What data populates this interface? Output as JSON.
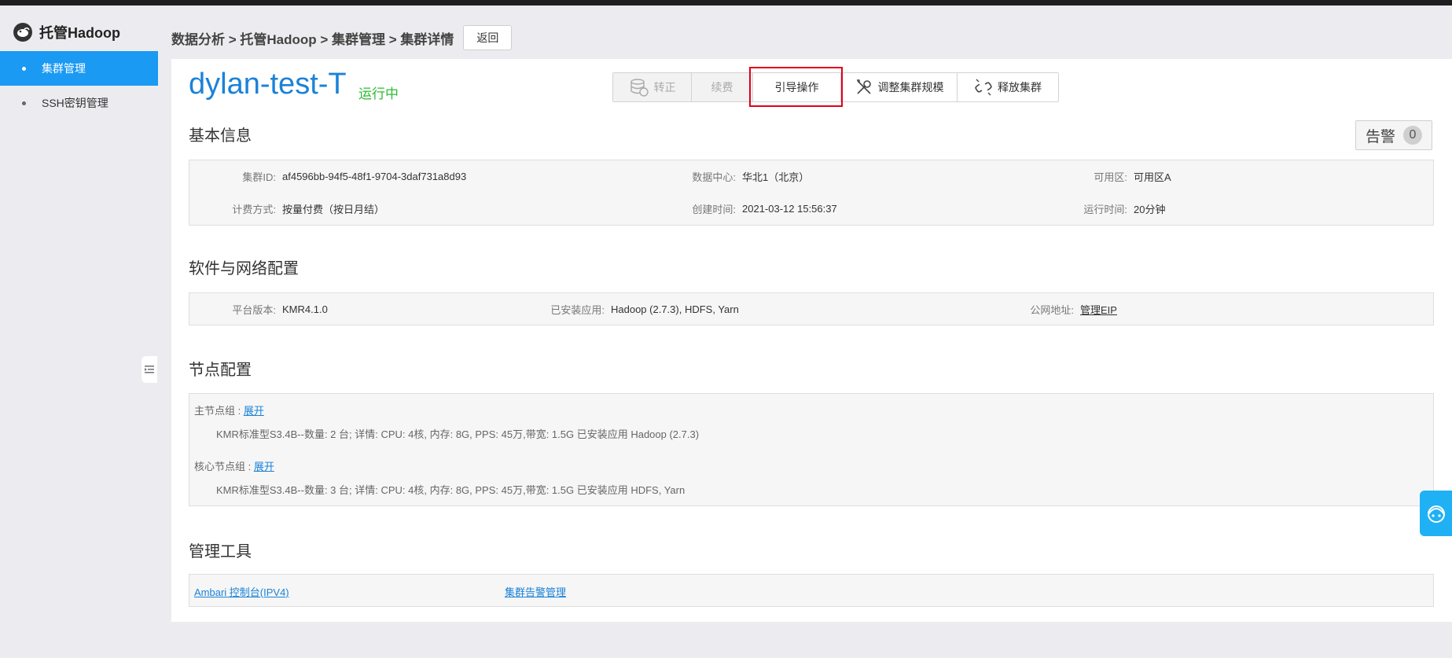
{
  "app": {
    "title": "托管Hadoop"
  },
  "sidebar": {
    "items": [
      {
        "label": "集群管理",
        "active": true
      },
      {
        "label": "SSH密钥管理",
        "active": false
      }
    ]
  },
  "header": {
    "breadcrumb": "数据分析 > 托管Hadoop > 集群管理 > 集群详情",
    "back_label": "返回"
  },
  "cluster": {
    "name": "dylan-test-T",
    "status": "运行中",
    "status_color": "#2ebb35"
  },
  "actions": {
    "convert": "转正",
    "renew": "续费",
    "guide": "引导操作",
    "resize": "调整集群规模",
    "release": "释放集群"
  },
  "alarm": {
    "label": "告警",
    "count": "0"
  },
  "basic_info": {
    "title": "基本信息",
    "cluster_id_label": "集群ID:",
    "cluster_id": "af4596bb-94f5-48f1-9704-3daf731a8d93",
    "datacenter_label": "数据中心:",
    "datacenter": "华北1（北京）",
    "zone_label": "可用区:",
    "zone": "可用区A",
    "billing_label": "计费方式:",
    "billing": "按量付费（按日月结）",
    "created_label": "创建时间:",
    "created": "2021-03-12 15:56:37",
    "uptime_label": "运行时间:",
    "uptime": "20分钟"
  },
  "software": {
    "title": "软件与网络配置",
    "platform_label": "平台版本:",
    "platform": "KMR4.1.0",
    "apps_label": "已安装应用:",
    "apps": "Hadoop (2.7.3), HDFS, Yarn",
    "public_label": "公网地址:",
    "public_link": "管理EIP"
  },
  "nodes": {
    "title": "节点配置",
    "master_label": "主节点组 : ",
    "master_link": "展开",
    "master_desc": "KMR标准型S3.4B--数量: 2 台;   详情:  CPU: 4核, 内存: 8G, PPS: 45万,带宽: 1.5G 已安装应用 Hadoop (2.7.3)",
    "core_label": "核心节点组 : ",
    "core_link": "展开",
    "core_desc": "KMR标准型S3.4B--数量: 3 台;   详情:  CPU: 4核, 内存: 8G, PPS: 45万,带宽: 1.5G 已安装应用 HDFS, Yarn"
  },
  "tools": {
    "title": "管理工具",
    "ambari": "Ambari 控制台(IPV4)",
    "alarm_mgmt": "集群告警管理"
  },
  "colors": {
    "accent": "#1a9af2",
    "link": "#1a82d8",
    "highlight": "#e0001b"
  }
}
